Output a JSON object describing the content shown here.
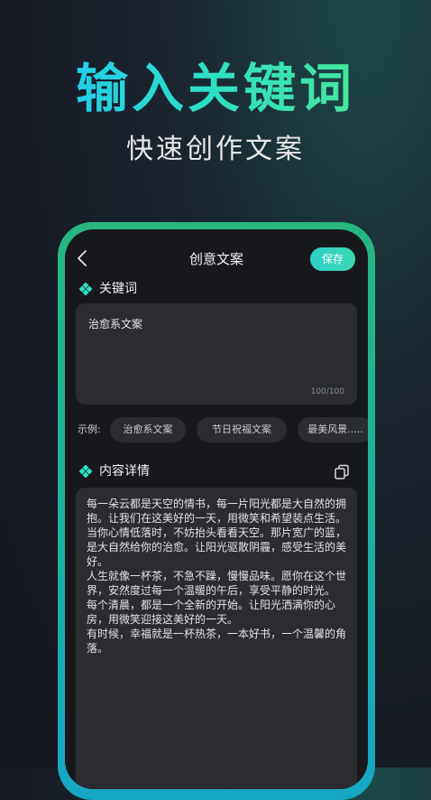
{
  "promo": {
    "headline": "输入关键词",
    "subtitle": "快速创作文案"
  },
  "colors": {
    "accent_start": "#1ec3ff",
    "accent_end": "#53ea8a",
    "phone_frame": "#1db39a",
    "save_button": "#2fd0c8",
    "panel": "#2a2c30"
  },
  "app": {
    "title": "创意文案",
    "back_icon": "chevron-left-icon",
    "save_label": "保存"
  },
  "keyword_section": {
    "icon": "diamond-icon",
    "label": "关键词",
    "value": "治愈系文案",
    "counter": "100/100"
  },
  "examples": {
    "label": "示例:",
    "chips": [
      "治愈系文案",
      "节日祝福文案",
      "最美风景....."
    ]
  },
  "content_section": {
    "icon": "diamond-icon",
    "label": "内容详情",
    "copy_icon": "copy-icon",
    "text": "每一朵云都是天空的情书，每一片阳光都是大自然的拥抱。让我们在这美好的一天，用微笑和希望装点生活。\n当你心情低落时，不妨抬头看看天空。那片宽广的蓝，是大自然给你的治愈。让阳光驱散阴霾，感受生活的美好。\n人生就像一杯茶，不急不躁，慢慢品味。愿你在这个世界，安然度过每一个温暖的午后，享受平静的时光。\n每个清晨，都是一个全新的开始。让阳光洒满你的心房，用微笑迎接这美好的一天。\n有时候，幸福就是一杯热茶，一本好书，一个温馨的角落。"
  }
}
